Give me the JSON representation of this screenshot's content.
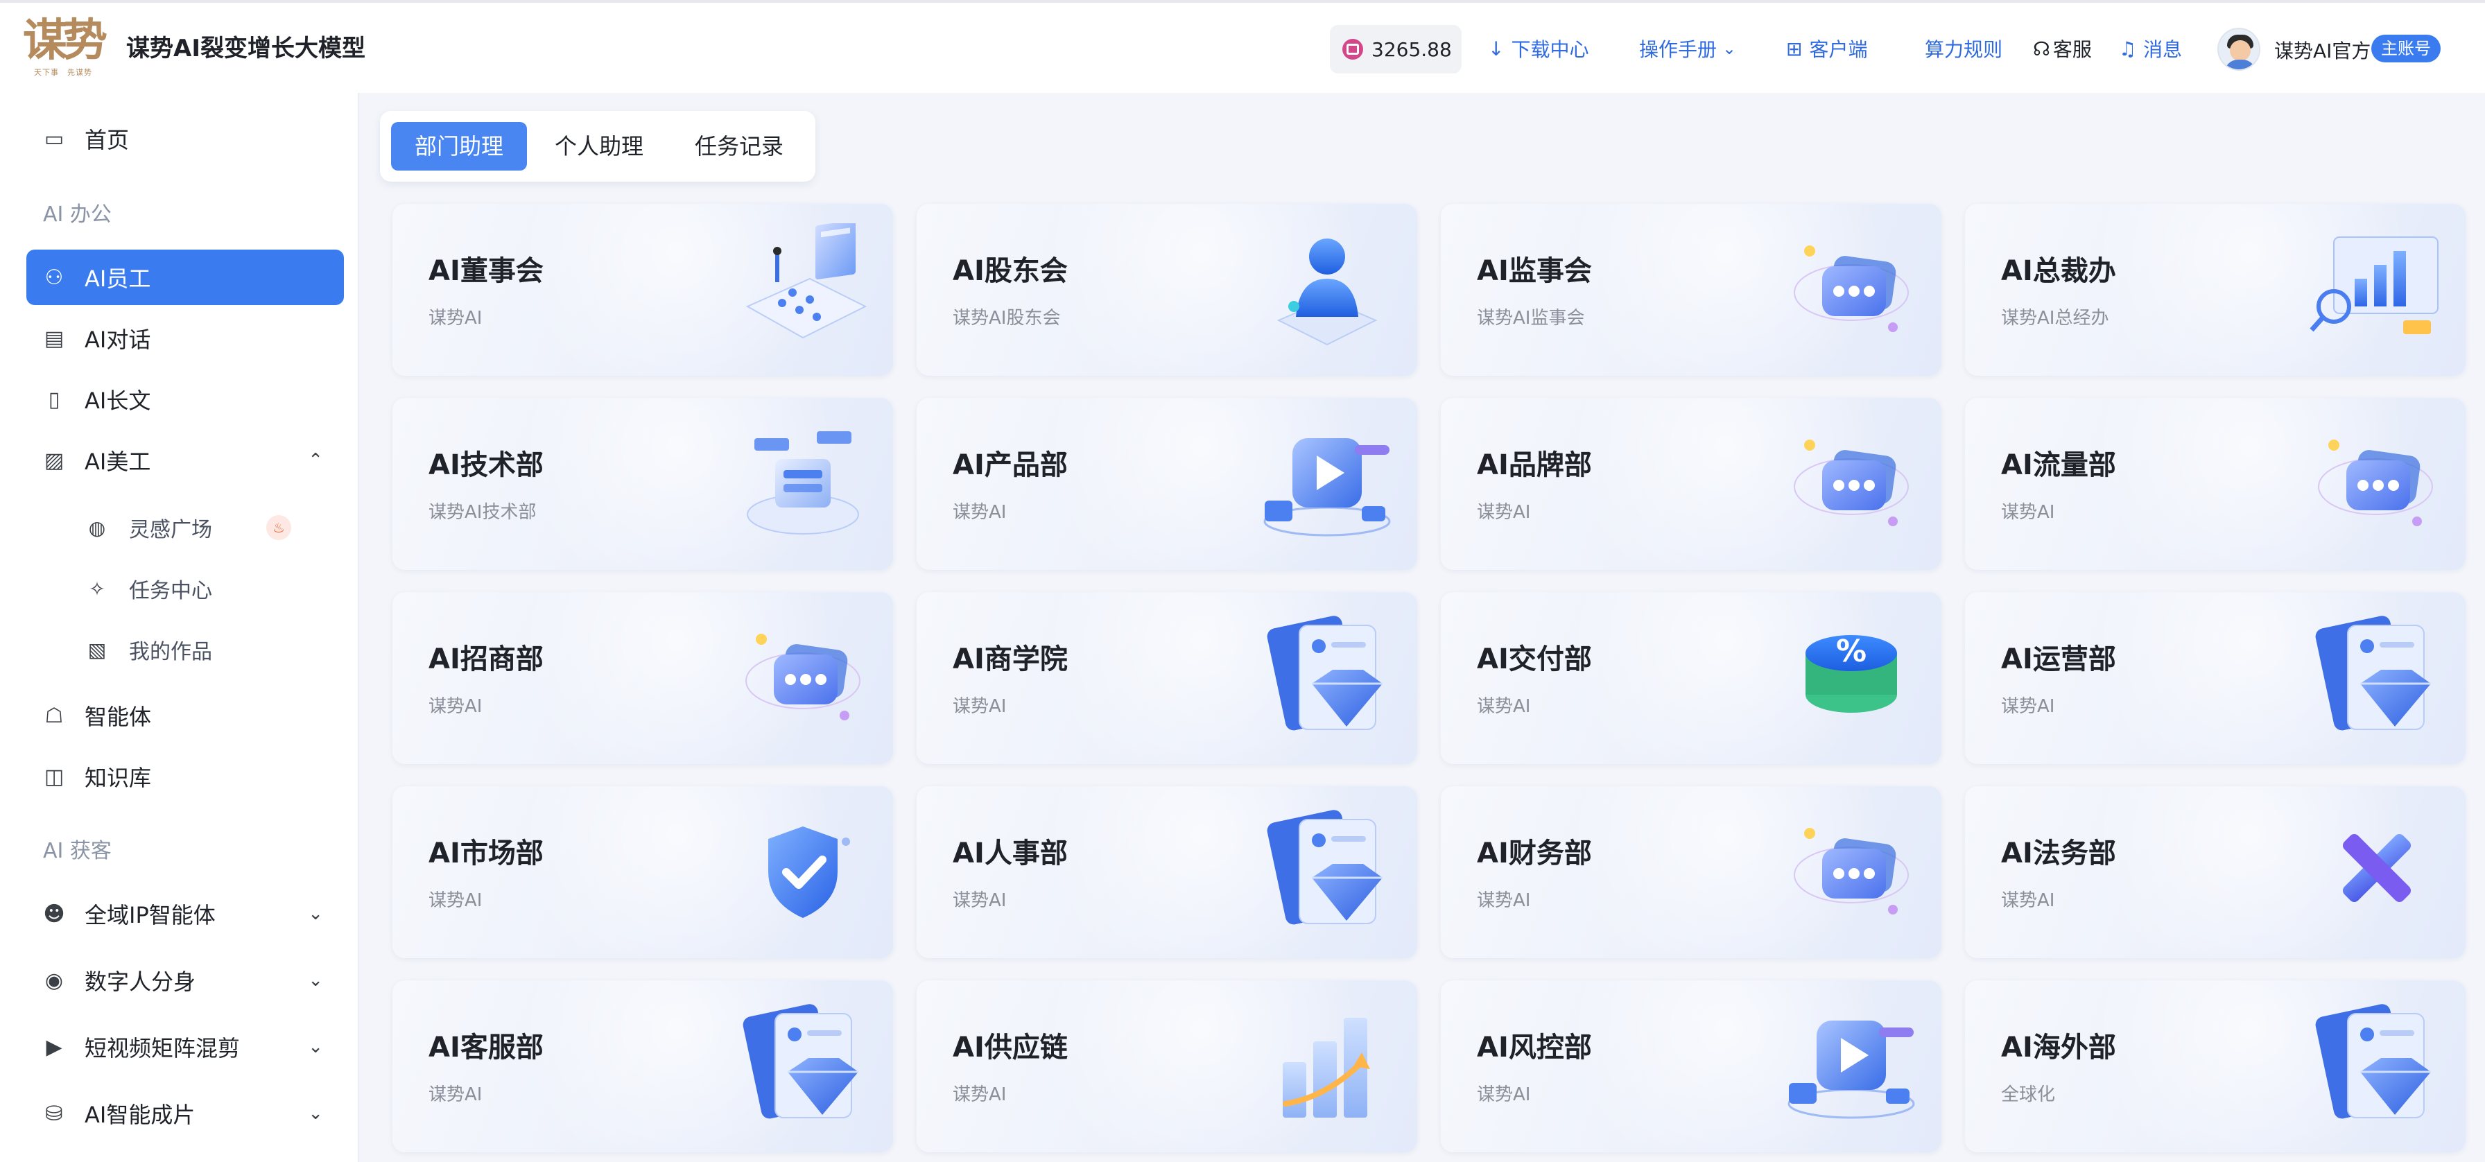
{
  "header": {
    "logo_glyph": "谋势",
    "logo_sub": "天下事　先谋势",
    "app_title": "谋势AI裂变增长大模型",
    "balance": "3265.88",
    "nav": {
      "download": "下载中心",
      "manual": "操作手册",
      "client": "客户端",
      "compute_rules": "算力规则",
      "service": "客服",
      "messages": "消息"
    },
    "user_name": "谋势AI官方",
    "account_badge": "主账号"
  },
  "sidebar": {
    "home": "首页",
    "group_office": "AI 办公",
    "ai_staff": "AI员工",
    "ai_chat": "AI对话",
    "ai_longtext": "AI长文",
    "ai_art": "AI美工",
    "sub_inspiration": "灵感广场",
    "sub_tasks": "任务中心",
    "sub_works": "我的作品",
    "agents": "智能体",
    "knowledge": "知识库",
    "group_acquire": "AI 获客",
    "ip_agent": "全域IP智能体",
    "digital_human": "数字人分身",
    "video_mix": "短视频矩阵混剪",
    "ai_film": "AI智能成片"
  },
  "tabs": [
    "部门助理",
    "个人助理",
    "任务记录"
  ],
  "cards": [
    {
      "title": "AI董事会",
      "sub": "谋势AI",
      "icon": "meeting-icon"
    },
    {
      "title": "AI股东会",
      "sub": "谋势AI股东会",
      "icon": "user-bust-icon"
    },
    {
      "title": "AI监事会",
      "sub": "谋势AI监事会",
      "icon": "chat-bubble-icon"
    },
    {
      "title": "AI总裁办",
      "sub": "谋势AI总经办",
      "icon": "bar-chart-icon"
    },
    {
      "title": "AI技术部",
      "sub": "谋势AI技术部",
      "icon": "server-icon"
    },
    {
      "title": "AI产品部",
      "sub": "谋势AI",
      "icon": "play-icon"
    },
    {
      "title": "AI品牌部",
      "sub": "谋势AI",
      "icon": "chat-bubble-icon"
    },
    {
      "title": "AI流量部",
      "sub": "谋势AI",
      "icon": "chat-bubble-icon"
    },
    {
      "title": "AI招商部",
      "sub": "谋势AI",
      "icon": "chat-bubble-icon"
    },
    {
      "title": "AI商学院",
      "sub": "谋势AI",
      "icon": "diamond-card-icon"
    },
    {
      "title": "AI交付部",
      "sub": "谋势AI",
      "icon": "percent-icon"
    },
    {
      "title": "AI运营部",
      "sub": "谋势AI",
      "icon": "diamond-card-icon"
    },
    {
      "title": "AI市场部",
      "sub": "谋势AI",
      "icon": "shield-check-icon"
    },
    {
      "title": "AI人事部",
      "sub": "谋势AI",
      "icon": "diamond-card-icon"
    },
    {
      "title": "AI财务部",
      "sub": "谋势AI",
      "icon": "chat-bubble-icon"
    },
    {
      "title": "AI法务部",
      "sub": "谋势AI",
      "icon": "cross-tools-icon"
    },
    {
      "title": "AI客服部",
      "sub": "谋势AI",
      "icon": "diamond-card-icon"
    },
    {
      "title": "AI供应链",
      "sub": "谋势AI",
      "icon": "growth-chart-icon"
    },
    {
      "title": "AI风控部",
      "sub": "谋势AI",
      "icon": "play-icon"
    },
    {
      "title": "AI海外部",
      "sub": "全球化",
      "icon": "diamond-card-icon"
    }
  ],
  "colors": {
    "accent": "#3a7cf0",
    "tab_active": "#4a86f2",
    "brand_gold": "#b58b5e"
  }
}
